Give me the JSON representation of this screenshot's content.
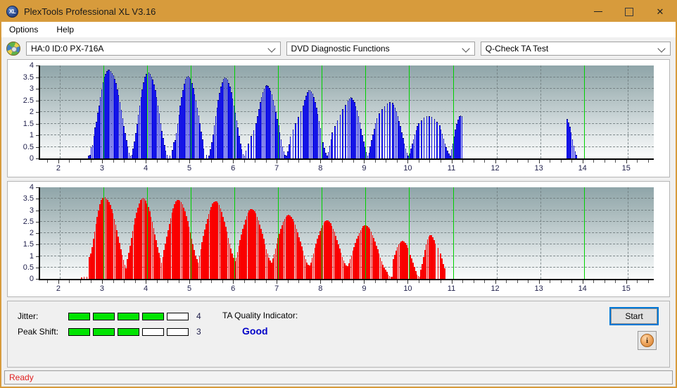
{
  "window": {
    "title": "PlexTools Professional XL V3.16",
    "app_icon": "xl-logo-icon",
    "minimize": "minimize-icon",
    "maximize": "maximize-icon",
    "close": "close-icon"
  },
  "menu": {
    "items": [
      {
        "label": "Options"
      },
      {
        "label": "Help"
      }
    ]
  },
  "selector": {
    "drive_icon": "disc-icon",
    "drive": "HA:0 ID:0  PX-716A",
    "function": "DVD Diagnostic Functions",
    "test": "Q-Check TA Test"
  },
  "status": {
    "text": "Ready"
  },
  "indicators": {
    "jitter_label": "Jitter:",
    "jitter_value": "4",
    "jitter_filled": 4,
    "jitter_total": 5,
    "peak_shift_label": "Peak Shift:",
    "peak_shift_value": "3",
    "peak_shift_filled": 3,
    "peak_shift_total": 5,
    "ta_title": "TA Quality Indicator:",
    "ta_value": "Good",
    "ta_color": "#0000c8",
    "segment_on_color": "#00e400"
  },
  "buttons": {
    "start": "Start",
    "info_icon": "info-icon",
    "info_glyph": "i"
  },
  "chart_data": [
    {
      "type": "bar",
      "name": "jitter-chart",
      "title": "",
      "xlabel": "",
      "ylabel": "",
      "color": "#1414e6",
      "xlim": [
        1.55,
        15.6
      ],
      "ylim": [
        0,
        4
      ],
      "yticks": [
        0,
        0.5,
        1,
        1.5,
        2,
        2.5,
        3,
        3.5,
        4
      ],
      "ytick_labels": [
        "0",
        "0.5",
        "1",
        "1.5",
        "2",
        "2.5",
        "3",
        "3.5",
        "4"
      ],
      "xticks": [
        2,
        3,
        4,
        5,
        6,
        7,
        8,
        9,
        10,
        11,
        12,
        13,
        14,
        15
      ],
      "xtick_labels": [
        "2",
        "3",
        "4",
        "5",
        "6",
        "7",
        "8",
        "9",
        "10",
        "11",
        "12",
        "13",
        "14",
        "15"
      ],
      "grid": true,
      "markers": [
        3,
        4,
        5,
        6,
        7,
        8,
        9,
        10,
        11,
        14
      ],
      "marker_color": "#00d000",
      "bar_width": 0.018,
      "x": [
        2.66,
        2.69,
        2.72,
        2.75,
        2.78,
        2.81,
        2.84,
        2.87,
        2.9,
        2.93,
        2.96,
        2.99,
        3.02,
        3.05,
        3.08,
        3.11,
        3.14,
        3.17,
        3.2,
        3.23,
        3.26,
        3.29,
        3.32,
        3.35,
        3.38,
        3.41,
        3.44,
        3.47,
        3.5,
        3.53,
        3.56,
        3.59,
        3.62,
        3.65,
        3.68,
        3.71,
        3.74,
        3.77,
        3.8,
        3.83,
        3.86,
        3.89,
        3.92,
        3.95,
        3.98,
        4.01,
        4.04,
        4.07,
        4.1,
        4.13,
        4.16,
        4.19,
        4.22,
        4.25,
        4.28,
        4.31,
        4.34,
        4.37,
        4.4,
        4.43,
        4.46,
        4.52,
        4.58,
        4.61,
        4.64,
        4.67,
        4.7,
        4.73,
        4.76,
        4.79,
        4.82,
        4.85,
        4.88,
        4.91,
        4.94,
        4.97,
        5.0,
        5.03,
        5.06,
        5.09,
        5.12,
        5.15,
        5.18,
        5.21,
        5.24,
        5.27,
        5.3,
        5.36,
        5.42,
        5.45,
        5.48,
        5.51,
        5.54,
        5.57,
        5.6,
        5.63,
        5.66,
        5.69,
        5.72,
        5.75,
        5.78,
        5.81,
        5.84,
        5.87,
        5.9,
        5.93,
        5.96,
        5.99,
        6.02,
        6.05,
        6.08,
        6.11,
        6.14,
        6.17,
        6.2,
        6.23,
        6.26,
        6.32,
        6.38,
        6.44,
        6.5,
        6.53,
        6.56,
        6.59,
        6.62,
        6.65,
        6.68,
        6.71,
        6.74,
        6.77,
        6.8,
        6.83,
        6.86,
        6.89,
        6.92,
        6.95,
        6.98,
        7.01,
        7.04,
        7.07,
        7.1,
        7.13,
        7.16,
        7.19,
        7.22,
        7.25,
        7.28,
        7.34,
        7.4,
        7.46,
        7.52,
        7.58,
        7.61,
        7.64,
        7.67,
        7.7,
        7.73,
        7.76,
        7.79,
        7.82,
        7.85,
        7.88,
        7.91,
        7.94,
        7.97,
        8.0,
        8.03,
        8.06,
        8.09,
        8.12,
        8.15,
        8.18,
        8.21,
        8.24,
        8.3,
        8.36,
        8.42,
        8.48,
        8.54,
        8.6,
        8.63,
        8.66,
        8.69,
        8.72,
        8.75,
        8.78,
        8.81,
        8.84,
        8.87,
        8.9,
        8.93,
        8.96,
        8.99,
        9.02,
        9.05,
        9.08,
        9.11,
        9.14,
        9.17,
        9.2,
        9.23,
        9.26,
        9.32,
        9.38,
        9.44,
        9.5,
        9.56,
        9.62,
        9.65,
        9.68,
        9.71,
        9.74,
        9.77,
        9.8,
        9.83,
        9.86,
        9.89,
        9.92,
        9.95,
        9.98,
        10.01,
        10.04,
        10.07,
        10.1,
        10.13,
        10.16,
        10.19,
        10.22,
        10.28,
        10.34,
        10.4,
        10.46,
        10.52,
        10.58,
        10.64,
        10.7,
        10.73,
        10.76,
        10.79,
        10.82,
        10.85,
        10.88,
        10.91,
        10.94,
        10.97,
        11.0,
        11.03,
        11.06,
        11.09,
        11.12,
        11.15,
        11.18,
        11.21,
        13.62,
        13.65,
        13.68,
        13.71,
        13.74,
        13.77,
        13.8,
        13.83,
        13.86,
        13.89,
        13.92,
        13.95,
        13.98,
        14.01,
        14.04,
        14.07,
        14.1
      ],
      "values": [
        0.1,
        0.12,
        0.45,
        0.55,
        0.95,
        1.3,
        1.55,
        1.95,
        2.25,
        2.6,
        2.95,
        3.25,
        3.5,
        3.62,
        3.72,
        3.78,
        3.8,
        3.72,
        3.65,
        3.55,
        3.4,
        3.2,
        2.95,
        2.7,
        2.4,
        2.05,
        1.7,
        1.35,
        1.05,
        0.75,
        0.5,
        0.22,
        0.1,
        0.12,
        0.4,
        0.7,
        1.05,
        1.45,
        1.85,
        2.25,
        2.6,
        2.95,
        3.25,
        3.5,
        3.62,
        3.7,
        3.68,
        3.6,
        3.5,
        3.35,
        3.15,
        2.9,
        2.6,
        2.25,
        1.9,
        1.5,
        1.15,
        0.85,
        0.55,
        0.3,
        0.12,
        0.1,
        0.32,
        0.68,
        0.75,
        1.05,
        1.45,
        1.85,
        2.25,
        2.6,
        2.9,
        3.18,
        3.38,
        3.48,
        3.52,
        3.46,
        3.38,
        3.22,
        3.0,
        2.72,
        2.45,
        2.15,
        1.82,
        1.48,
        1.12,
        0.78,
        0.4,
        0.12,
        0.1,
        0.35,
        0.68,
        1.0,
        1.4,
        1.78,
        2.15,
        2.48,
        2.78,
        3.05,
        3.25,
        3.38,
        3.45,
        3.42,
        3.35,
        3.22,
        3.05,
        2.82,
        2.55,
        2.25,
        1.95,
        1.62,
        1.3,
        0.95,
        0.62,
        0.35,
        0.15,
        0.1,
        0.3,
        0.62,
        0.95,
        1.18,
        1.48,
        1.8,
        2.1,
        2.38,
        2.62,
        2.82,
        2.98,
        3.08,
        3.12,
        3.08,
        3.0,
        2.88,
        2.72,
        2.5,
        2.25,
        1.98,
        1.68,
        1.38,
        1.08,
        0.78,
        0.5,
        0.28,
        0.12,
        0.1,
        0.28,
        0.58,
        0.9,
        1.2,
        1.48,
        1.75,
        2.0,
        2.25,
        2.48,
        2.68,
        2.82,
        2.9,
        2.92,
        2.86,
        2.75,
        2.6,
        2.4,
        2.15,
        1.88,
        1.58,
        1.28,
        0.98,
        0.68,
        0.42,
        0.22,
        0.1,
        0.25,
        0.52,
        0.8,
        1.08,
        1.35,
        1.6,
        1.85,
        2.08,
        2.28,
        2.45,
        2.55,
        2.6,
        2.58,
        2.5,
        2.38,
        2.22,
        2.02,
        1.78,
        1.52,
        1.25,
        0.98,
        0.7,
        0.45,
        0.25,
        0.1,
        0.22,
        0.48,
        0.75,
        1.0,
        1.25,
        1.48,
        1.7,
        1.9,
        2.08,
        2.22,
        2.32,
        2.38,
        2.36,
        2.28,
        2.16,
        2.0,
        1.8,
        1.58,
        1.35,
        1.1,
        0.85,
        0.62,
        0.4,
        0.2,
        0.1,
        0.18,
        0.38,
        0.6,
        0.8,
        1.0,
        1.18,
        1.35,
        1.5,
        1.62,
        1.72,
        1.78,
        1.8,
        1.76,
        1.68,
        1.55,
        1.4,
        1.22,
        1.02,
        0.82,
        0.62,
        0.45,
        0.3,
        0.18,
        0.1,
        0.35,
        0.6,
        0.9,
        1.2,
        1.45,
        1.65,
        1.78,
        1.82,
        1.78,
        1.68,
        1.52,
        1.32,
        1.08,
        0.8,
        0.52,
        0.28,
        0.12
      ]
    },
    {
      "type": "bar",
      "name": "peak-shift-chart",
      "title": "",
      "xlabel": "",
      "ylabel": "",
      "color": "#fa0000",
      "xlim": [
        1.55,
        15.6
      ],
      "ylim": [
        0,
        4
      ],
      "yticks": [
        0,
        0.5,
        1,
        1.5,
        2,
        2.5,
        3,
        3.5,
        4
      ],
      "ytick_labels": [
        "0",
        "0.5",
        "1",
        "1.5",
        "2",
        "2.5",
        "3",
        "3.5",
        "4"
      ],
      "xticks": [
        2,
        3,
        4,
        5,
        6,
        7,
        8,
        9,
        10,
        11,
        12,
        13,
        14,
        15
      ],
      "xtick_labels": [
        "2",
        "3",
        "4",
        "5",
        "6",
        "7",
        "8",
        "9",
        "10",
        "11",
        "12",
        "13",
        "14",
        "15"
      ],
      "grid": true,
      "markers": [
        3,
        4,
        5,
        6,
        7,
        8,
        9,
        10,
        11,
        14
      ],
      "marker_color": "#00d000",
      "bar_width": 0.026,
      "x": [
        2.5,
        2.56,
        2.62,
        2.68,
        2.71,
        2.74,
        2.77,
        2.8,
        2.83,
        2.86,
        2.89,
        2.92,
        2.95,
        2.98,
        3.01,
        3.04,
        3.07,
        3.1,
        3.13,
        3.16,
        3.19,
        3.22,
        3.25,
        3.28,
        3.31,
        3.34,
        3.37,
        3.4,
        3.43,
        3.46,
        3.49,
        3.52,
        3.55,
        3.58,
        3.61,
        3.64,
        3.67,
        3.7,
        3.73,
        3.76,
        3.79,
        3.82,
        3.85,
        3.88,
        3.91,
        3.94,
        3.97,
        4.0,
        4.03,
        4.06,
        4.09,
        4.12,
        4.15,
        4.18,
        4.21,
        4.24,
        4.27,
        4.3,
        4.33,
        4.36,
        4.39,
        4.42,
        4.45,
        4.48,
        4.51,
        4.54,
        4.57,
        4.6,
        4.63,
        4.66,
        4.69,
        4.72,
        4.75,
        4.78,
        4.81,
        4.84,
        4.87,
        4.9,
        4.93,
        4.96,
        4.99,
        5.02,
        5.05,
        5.08,
        5.11,
        5.14,
        5.17,
        5.2,
        5.23,
        5.26,
        5.29,
        5.32,
        5.35,
        5.38,
        5.41,
        5.44,
        5.47,
        5.5,
        5.53,
        5.56,
        5.59,
        5.62,
        5.65,
        5.68,
        5.71,
        5.74,
        5.77,
        5.8,
        5.83,
        5.86,
        5.89,
        5.92,
        5.95,
        5.98,
        6.01,
        6.04,
        6.07,
        6.1,
        6.13,
        6.16,
        6.19,
        6.22,
        6.25,
        6.28,
        6.31,
        6.34,
        6.37,
        6.4,
        6.43,
        6.46,
        6.49,
        6.52,
        6.55,
        6.58,
        6.61,
        6.64,
        6.67,
        6.7,
        6.73,
        6.76,
        6.79,
        6.82,
        6.85,
        6.88,
        6.91,
        6.94,
        6.97,
        7.0,
        7.03,
        7.06,
        7.09,
        7.12,
        7.15,
        7.18,
        7.21,
        7.24,
        7.27,
        7.3,
        7.33,
        7.36,
        7.39,
        7.42,
        7.45,
        7.48,
        7.51,
        7.54,
        7.57,
        7.6,
        7.63,
        7.66,
        7.69,
        7.72,
        7.75,
        7.78,
        7.81,
        7.84,
        7.87,
        7.9,
        7.93,
        7.96,
        7.99,
        8.02,
        8.05,
        8.08,
        8.11,
        8.14,
        8.17,
        8.2,
        8.23,
        8.26,
        8.29,
        8.32,
        8.35,
        8.38,
        8.41,
        8.44,
        8.47,
        8.5,
        8.53,
        8.56,
        8.59,
        8.62,
        8.65,
        8.68,
        8.71,
        8.74,
        8.77,
        8.8,
        8.83,
        8.86,
        8.89,
        8.92,
        8.95,
        8.98,
        9.01,
        9.04,
        9.07,
        9.1,
        9.13,
        9.16,
        9.19,
        9.22,
        9.25,
        9.28,
        9.31,
        9.34,
        9.37,
        9.4,
        9.43,
        9.46,
        9.49,
        9.52,
        9.55,
        9.58,
        9.61,
        9.64,
        9.67,
        9.7,
        9.73,
        9.76,
        9.79,
        9.82,
        9.85,
        9.88,
        9.91,
        9.94,
        9.97,
        10.0,
        10.03,
        10.06,
        10.09,
        10.12,
        10.15,
        10.18,
        10.21,
        10.24,
        10.27,
        10.3,
        10.33,
        10.36,
        10.39,
        10.42,
        10.45,
        10.48,
        10.51,
        10.54,
        10.57,
        10.6,
        10.66,
        10.72,
        10.75,
        10.78,
        10.81,
        10.84,
        10.87,
        10.9,
        10.93,
        10.96,
        10.99,
        11.02,
        11.05,
        11.08,
        11.11,
        11.14,
        11.17,
        11.2,
        11.23,
        11.26,
        11.32,
        11.44,
        13.7,
        13.76,
        13.82,
        13.85,
        13.88,
        13.91,
        13.94,
        13.97,
        14.0,
        14.03,
        14.06,
        14.09,
        14.12,
        14.15,
        14.18,
        14.21,
        14.24
      ],
      "values": [
        0.06,
        0.1,
        0.08,
        0.95,
        1.1,
        1.4,
        1.75,
        2.05,
        2.4,
        2.7,
        3.0,
        3.25,
        3.45,
        3.55,
        3.6,
        3.58,
        3.52,
        3.45,
        3.35,
        3.22,
        3.05,
        2.85,
        2.62,
        2.38,
        2.12,
        1.85,
        1.58,
        1.3,
        1.05,
        0.82,
        0.62,
        0.45,
        0.85,
        1.15,
        1.45,
        1.78,
        2.08,
        2.38,
        2.65,
        2.9,
        3.12,
        3.3,
        3.45,
        3.52,
        3.55,
        3.5,
        3.42,
        3.3,
        3.15,
        2.95,
        2.72,
        2.48,
        2.22,
        1.95,
        1.68,
        1.4,
        1.15,
        0.92,
        0.72,
        0.95,
        1.25,
        1.55,
        1.85,
        2.12,
        2.4,
        2.65,
        2.88,
        3.08,
        3.25,
        3.38,
        3.45,
        3.46,
        3.42,
        3.35,
        3.25,
        3.12,
        2.95,
        2.75,
        2.52,
        2.28,
        2.02,
        1.75,
        1.5,
        1.25,
        1.02,
        0.85,
        0.72,
        1.0,
        1.3,
        1.6,
        1.88,
        2.15,
        2.4,
        2.62,
        2.82,
        3.0,
        3.15,
        3.28,
        3.36,
        3.4,
        3.38,
        3.32,
        3.22,
        3.08,
        2.92,
        2.72,
        2.5,
        2.28,
        2.05,
        1.8,
        1.55,
        1.32,
        1.1,
        0.92,
        0.78,
        0.92,
        1.18,
        1.45,
        1.7,
        1.95,
        2.18,
        2.38,
        2.58,
        2.75,
        2.88,
        2.98,
        3.04,
        3.05,
        3.02,
        2.95,
        2.85,
        2.72,
        2.55,
        2.38,
        2.18,
        1.96,
        1.74,
        1.52,
        1.3,
        1.1,
        0.92,
        0.8,
        0.72,
        0.88,
        1.08,
        1.32,
        1.55,
        1.78,
        1.98,
        2.18,
        2.35,
        2.5,
        2.62,
        2.72,
        2.78,
        2.8,
        2.78,
        2.72,
        2.62,
        2.5,
        2.36,
        2.2,
        2.02,
        1.82,
        1.62,
        1.42,
        1.22,
        1.02,
        0.85,
        0.72,
        0.62,
        0.58,
        0.72,
        0.92,
        1.12,
        1.35,
        1.55,
        1.75,
        1.92,
        2.08,
        2.22,
        2.35,
        2.45,
        2.52,
        2.55,
        2.54,
        2.5,
        2.42,
        2.32,
        2.2,
        2.05,
        1.88,
        1.7,
        1.52,
        1.32,
        1.14,
        0.96,
        0.8,
        0.68,
        0.58,
        0.55,
        0.68,
        0.85,
        1.02,
        1.22,
        1.4,
        1.58,
        1.74,
        1.88,
        2.0,
        2.12,
        2.22,
        2.3,
        2.34,
        2.35,
        2.32,
        2.26,
        2.18,
        2.06,
        1.92,
        1.78,
        1.62,
        1.45,
        1.28,
        1.1,
        0.92,
        0.76,
        0.62,
        0.5,
        0.4,
        0.3,
        0.2,
        0.12,
        0.08,
        0.1,
        0.85,
        1.05,
        1.22,
        1.38,
        1.5,
        1.58,
        1.62,
        1.65,
        1.62,
        1.56,
        1.48,
        1.36,
        1.22,
        1.06,
        0.88,
        0.7,
        0.52,
        0.35,
        0.2,
        0.12,
        0.08,
        0.4,
        0.65,
        0.95,
        1.25,
        1.52,
        1.72,
        1.85,
        1.92,
        1.9,
        1.82,
        1.7,
        1.54,
        1.34,
        1.12,
        0.88,
        0.65,
        0.45
      ]
    }
  ]
}
